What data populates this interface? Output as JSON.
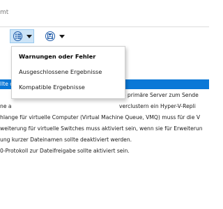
{
  "header": {
    "title_fragment": "mt"
  },
  "toolbar": {
    "filter_button": {
      "icon": "filter-list-icon",
      "dropdown_icon": "chevron-down-icon"
    },
    "save_button": {
      "icon": "save-icon",
      "dropdown_icon": "chevron-down-icon"
    },
    "accent_color": "#1e5aa8",
    "active_bg": "#cce4f7"
  },
  "filter_menu": {
    "items": [
      {
        "label": "Warnungen oder Fehler",
        "bold": true
      },
      {
        "label": "Ausgeschlossene Ergebnisse",
        "bold": false
      },
      {
        "label": "Kompatible Ergebnisse",
        "bold": false
      }
    ]
  },
  "results": {
    "selection_color": "#0a78d7",
    "rows": [
      {
        "left": "llte c",
        "right": "",
        "selected": true
      },
      {
        "left": "",
        "right": "he primäre Server zum Sende",
        "selected": false
      },
      {
        "left": "ne a",
        "right": "verclustern ein Hyper-V-Repli",
        "selected": false
      },
      {
        "left": "hlange für virtuelle Computer (Virtual Machine Queue, VMQ) muss für die V",
        "right": "",
        "selected": false
      },
      {
        "left": "weiterung für virtuelle Switches muss aktiviert sein, wenn sie für Erweiterun",
        "right": "",
        "selected": false
      },
      {
        "left": "ung kurzer Dateinamen sollte deaktiviert werden.",
        "right": "",
        "selected": false
      },
      {
        "left": "0-Protokoll zur Dateifreigabe sollte aktiviert sein.",
        "right": "",
        "selected": false
      }
    ]
  }
}
